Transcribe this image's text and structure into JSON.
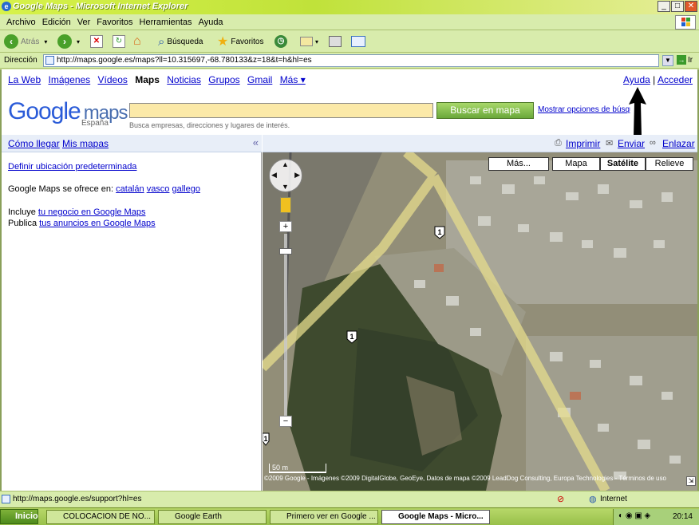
{
  "window": {
    "title": "Google Maps - Microsoft Internet Explorer"
  },
  "menu": [
    "Archivo",
    "Edición",
    "Ver",
    "Favoritos",
    "Herramientas",
    "Ayuda"
  ],
  "toolbar": {
    "back": "Atrás",
    "search": "Búsqueda",
    "favorites": "Favoritos"
  },
  "address": {
    "label": "Dirección",
    "url": "http://maps.google.es/maps?ll=10.315697,-68.780133&z=18&t=h&hl=es",
    "go": "Ir"
  },
  "gbar": {
    "links": [
      "La Web",
      "Imágenes",
      "Vídeos",
      "Maps",
      "Noticias",
      "Grupos",
      "Gmail",
      "Más ▾"
    ],
    "help": "Ayuda",
    "separator": "|",
    "login": "Acceder"
  },
  "logo": {
    "google": "Google",
    "maps": "maps",
    "country": "España"
  },
  "search": {
    "value": "",
    "button": "Buscar en mapa",
    "options": "Mostrar opciones de búsqueda",
    "hint": "Busca empresas, direcciones y lugares de interés."
  },
  "panel": {
    "tab_directions": "Cómo llegar",
    "tab_mymaps": "Mis mapas",
    "collapse": "«",
    "default_location": "Definir ubicación predeterminada",
    "offered_in": "Google Maps se ofrece en:",
    "languages": [
      "catalán",
      "vasco",
      "gallego"
    ],
    "includes": "Incluye",
    "business_link": "tu negocio en Google Maps",
    "publish": "Publica",
    "ads_link": "tus anuncios en Google Maps"
  },
  "maplinks": {
    "print": "Imprimir",
    "send": "Enviar",
    "link": "Enlazar"
  },
  "maptypes": {
    "more": "Más...",
    "map": "Mapa",
    "satellite": "Satélite",
    "terrain": "Relieve",
    "selected": "Satélite"
  },
  "map": {
    "scale": "50 m",
    "copyright": "©2009 Google - Imágenes ©2009 DigitalGlobe, GeoEye, Datos de mapa ©2009 LeadDog Consulting, Europa Technologies - Términos de uso",
    "road_shields": [
      "1",
      "1",
      "1"
    ]
  },
  "status": {
    "text": "http://maps.google.es/support?hl=es",
    "zone": "Internet"
  },
  "taskbar": {
    "start": "Inicio",
    "tasks": [
      "COLOCACION DE NO...",
      "Google Earth",
      "Primero ver en Google ...",
      "Google Maps - Micro..."
    ],
    "clock": "20:14"
  }
}
